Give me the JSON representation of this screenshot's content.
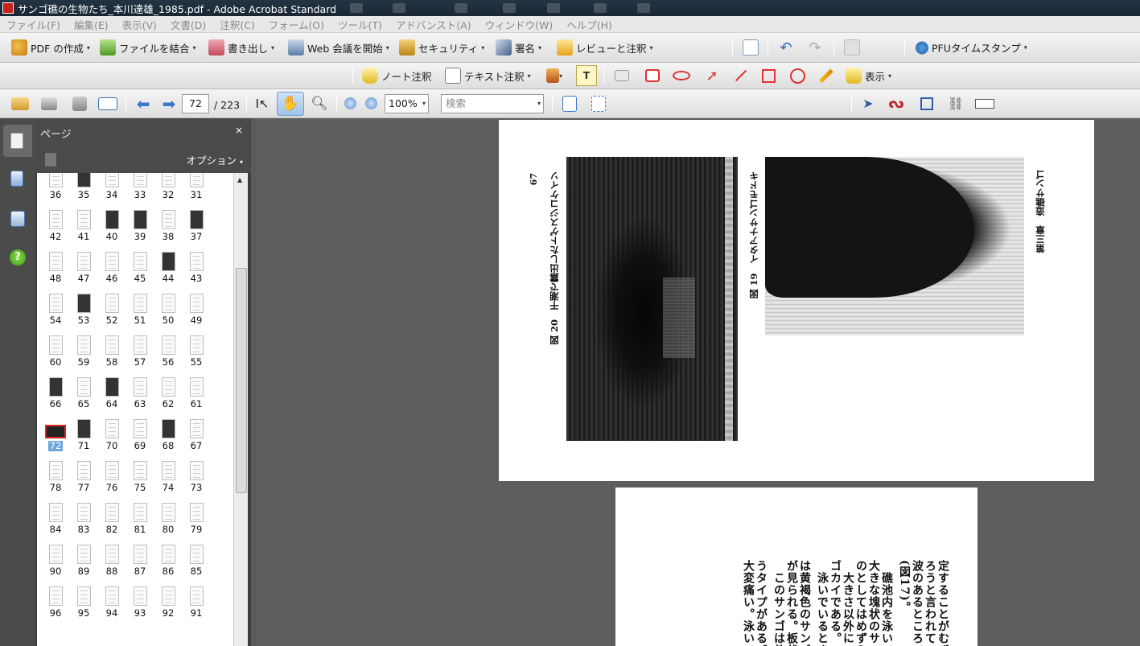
{
  "window": {
    "title": "サンゴ礁の生物たち_本川達雄_1985.pdf - Adobe Acrobat Standard"
  },
  "menu": [
    "ファイル(F)",
    "編集(E)",
    "表示(V)",
    "文書(D)",
    "注釈(C)",
    "フォーム(O)",
    "ツール(T)",
    "アドバンスト(A)",
    "ウィンドウ(W)",
    "ヘルプ(H)"
  ],
  "toolbar1": {
    "create_pdf": "PDF の作成",
    "combine": "ファイルを結合",
    "export": "書き出し",
    "web_meeting": "Web 会議を開始",
    "security": "セキュリティ",
    "sign": "署名",
    "review": "レビューと注釈",
    "timestamp": "PFUタイムスタンプ"
  },
  "toolbar2": {
    "note": "ノート注釈",
    "text_annot": "テキスト注釈",
    "show": "表示"
  },
  "toolbar3": {
    "page_current": "72",
    "page_total": "/ 223",
    "zoom": "100%",
    "search_placeholder": "検索"
  },
  "panel": {
    "title": "ページ",
    "close": "×",
    "options": "オプション",
    "thumbnails": [
      [
        "36",
        "35",
        "34",
        "33",
        "32",
        "31"
      ],
      [
        "42",
        "41",
        "40",
        "39",
        "38",
        "37"
      ],
      [
        "48",
        "47",
        "46",
        "45",
        "44",
        "43"
      ],
      [
        "54",
        "53",
        "52",
        "51",
        "50",
        "49"
      ],
      [
        "60",
        "59",
        "58",
        "57",
        "56",
        "55"
      ],
      [
        "66",
        "65",
        "64",
        "63",
        "62",
        "61"
      ],
      [
        "72",
        "71",
        "70",
        "69",
        "68",
        "67"
      ],
      [
        "78",
        "77",
        "76",
        "75",
        "74",
        "73"
      ],
      [
        "84",
        "83",
        "82",
        "81",
        "80",
        "79"
      ],
      [
        "90",
        "89",
        "88",
        "87",
        "86",
        "85"
      ],
      [
        "96",
        "95",
        "94",
        "93",
        "92",
        "91"
      ]
    ],
    "selected_page": "72"
  },
  "document": {
    "page1": {
      "page_number": "67",
      "fig20_caption": "図 20　干潮で露出したトゲスジコケイソ",
      "fig19_caption": "図 19　イタアナサンゴモドキ",
      "header": "第三章　造礁サンゴ"
    },
    "page2": {
      "columns": [
        "定することがむず",
        "ろうと言われてい",
        "波のあるところで",
        "(図17)。",
        "　礁池内を泳いで",
        "大きな塊状のサン",
        "のとしてはめずら",
        "　大きさ以外にこ",
        "ゴカイである。こ",
        "　泳いでいるとき",
        "は黄褐色のサンゴ",
        "が見られる。板状",
        "　このサンゴは他",
        "うタイプがある。",
        "大変痛い。泳いで"
      ]
    }
  }
}
